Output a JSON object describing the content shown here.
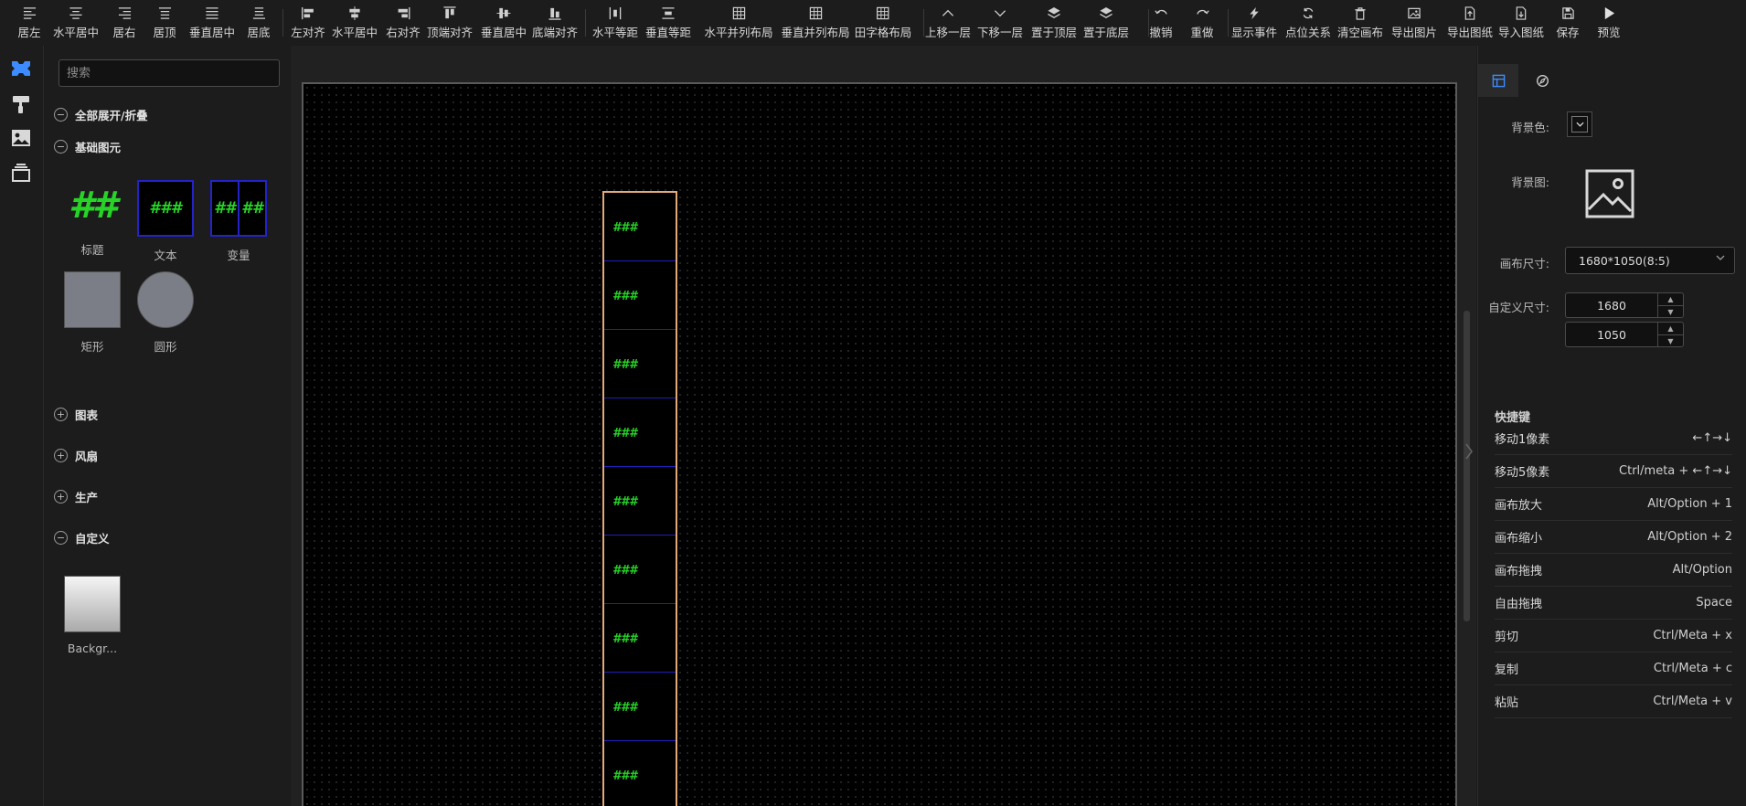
{
  "toolbar": [
    {
      "name": "align-left",
      "label": "居左",
      "icon": "align-left-icon"
    },
    {
      "name": "center-horizontal",
      "label": "水平居中",
      "icon": "center-h-icon"
    },
    {
      "name": "align-right",
      "label": "居右",
      "icon": "align-right-icon"
    },
    {
      "name": "align-top",
      "label": "居顶",
      "icon": "align-top-icon"
    },
    {
      "name": "center-vertical",
      "label": "垂直居中",
      "icon": "center-v-icon"
    },
    {
      "name": "align-bottom",
      "label": "居底",
      "icon": "align-bottom-icon"
    },
    {
      "name": "left-align",
      "label": "左对齐",
      "icon": "left-align-icon"
    },
    {
      "name": "h-center-align",
      "label": "水平居中",
      "icon": "h-center-align-icon"
    },
    {
      "name": "right-align",
      "label": "右对齐",
      "icon": "right-align-icon"
    },
    {
      "name": "top-align",
      "label": "顶端对齐",
      "icon": "top-align-icon"
    },
    {
      "name": "v-center-align",
      "label": "垂直居中",
      "icon": "v-center-align-icon"
    },
    {
      "name": "bottom-align",
      "label": "底端对齐",
      "icon": "bottom-align-icon"
    },
    {
      "name": "h-distribute",
      "label": "水平等距",
      "icon": "h-distribute-icon"
    },
    {
      "name": "v-distribute",
      "label": "垂直等距",
      "icon": "v-distribute-icon"
    },
    {
      "name": "h-layout",
      "label": "水平并列布局",
      "icon": "grid-icon"
    },
    {
      "name": "v-layout",
      "label": "垂直并列布局",
      "icon": "grid-icon"
    },
    {
      "name": "tian-layout",
      "label": "田字格布局",
      "icon": "grid-icon"
    },
    {
      "name": "move-up",
      "label": "上移一层",
      "icon": "chevron-up-icon"
    },
    {
      "name": "move-down",
      "label": "下移一层",
      "icon": "chevron-down-icon"
    },
    {
      "name": "bring-top",
      "label": "置于顶层",
      "icon": "layers-icon"
    },
    {
      "name": "send-bottom",
      "label": "置于底层",
      "icon": "layers-icon"
    },
    {
      "name": "undo",
      "label": "撤销",
      "icon": "undo-icon"
    },
    {
      "name": "redo",
      "label": "重做",
      "icon": "redo-icon"
    },
    {
      "name": "show-events",
      "label": "显示事件",
      "icon": "lightning-icon"
    },
    {
      "name": "point-relation",
      "label": "点位关系",
      "icon": "sync-icon"
    },
    {
      "name": "clear-canvas",
      "label": "清空画布",
      "icon": "trash-icon"
    },
    {
      "name": "export-image",
      "label": "导出图片",
      "icon": "image-icon"
    },
    {
      "name": "export-drawing",
      "label": "导出图纸",
      "icon": "export-file-icon"
    },
    {
      "name": "import-drawing",
      "label": "导入图纸",
      "icon": "import-file-icon"
    },
    {
      "name": "save",
      "label": "保存",
      "icon": "save-icon"
    },
    {
      "name": "preview",
      "label": "预览",
      "icon": "play-icon"
    }
  ],
  "rail": [
    {
      "name": "components",
      "icon": "components-icon"
    },
    {
      "name": "styles",
      "icon": "paint-roller-icon"
    },
    {
      "name": "images",
      "icon": "image-icon"
    },
    {
      "name": "layers",
      "icon": "layers-icon"
    }
  ],
  "panel": {
    "search_placeholder": "搜索",
    "expand_all": "全部展开/折叠",
    "group_basic": "基础图元",
    "components": [
      {
        "label": "标题",
        "kind": "title",
        "text": "##"
      },
      {
        "label": "文本",
        "kind": "text",
        "text": "###"
      },
      {
        "label": "变量",
        "kind": "variable",
        "text": [
          "##",
          "##"
        ]
      },
      {
        "label": "矩形",
        "kind": "rect"
      },
      {
        "label": "圆形",
        "kind": "circle"
      }
    ],
    "groups": [
      "图表",
      "风扇",
      "生产",
      "自定义"
    ],
    "custom_components": [
      {
        "label": "Backgr...",
        "kind": "background"
      }
    ]
  },
  "canvas": {
    "cell_text": "###",
    "cell_count": 9,
    "colors": {
      "selection": "#e3a978",
      "cell_border": "#1f1fb8",
      "hash_text": "#27d327"
    }
  },
  "right": {
    "tabs": [
      {
        "name": "page-settings",
        "icon": "layout-icon"
      },
      {
        "name": "global-settings",
        "icon": "compass-icon"
      }
    ],
    "bg_color_label": "背景色:",
    "bg_image_label": "背景图:",
    "canvas_size_label": "画布尺寸:",
    "canvas_size_value": "1680*1050(8:5)",
    "custom_size_label": "自定义尺寸:",
    "width": "1680",
    "height": "1050",
    "shortcuts_title": "快捷键",
    "shortcuts": [
      {
        "k": "移动1像素",
        "v": "←↑→↓"
      },
      {
        "k": "移动5像素",
        "v": "Ctrl/meta + ←↑→↓"
      },
      {
        "k": "画布放大",
        "v": "Alt/Option + 1"
      },
      {
        "k": "画布缩小",
        "v": "Alt/Option + 2"
      },
      {
        "k": "画布拖拽",
        "v": "Alt/Option"
      },
      {
        "k": "自由拖拽",
        "v": "Space"
      },
      {
        "k": "剪切",
        "v": "Ctrl/Meta + x"
      },
      {
        "k": "复制",
        "v": "Ctrl/Meta + c"
      },
      {
        "k": "粘贴",
        "v": "Ctrl/Meta + v"
      }
    ]
  }
}
